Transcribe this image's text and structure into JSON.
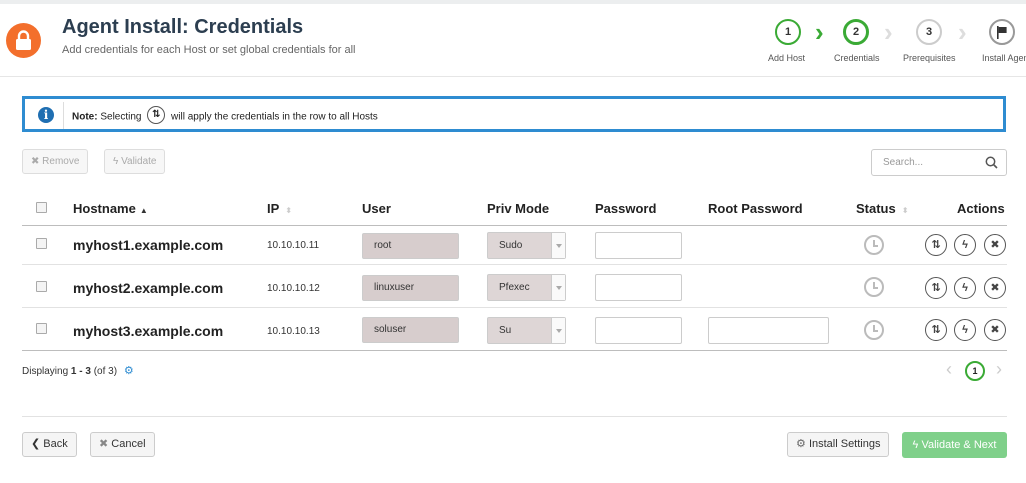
{
  "header": {
    "title": "Agent Install: Credentials",
    "subtitle": "Add credentials for each Host or set global credentials for all"
  },
  "stepper": {
    "steps": [
      {
        "number": "1",
        "label": "Add Host",
        "state": "done"
      },
      {
        "number": "2",
        "label": "Credentials",
        "state": "current"
      },
      {
        "number": "3",
        "label": "Prerequisites",
        "state": "pending"
      },
      {
        "number": "",
        "label": "Install Agent",
        "state": "pending",
        "icon": "flag-icon"
      }
    ]
  },
  "note": {
    "prefix": "Note:",
    "text_before": "Selecting",
    "text_after": "will apply the credentials in the row to all Hosts"
  },
  "toolbar": {
    "remove_label": "Remove",
    "validate_label": "Validate",
    "search_placeholder": "Search..."
  },
  "table": {
    "columns": {
      "hostname": "Hostname",
      "ip": "IP",
      "user": "User",
      "priv_mode": "Priv Mode",
      "password": "Password",
      "root_password": "Root Password",
      "status": "Status",
      "actions": "Actions"
    },
    "rows": [
      {
        "hostname": "myhost1.example.com",
        "ip": "10.10.10.11",
        "user": "root",
        "priv_mode": "Sudo",
        "has_root_password": false
      },
      {
        "hostname": "myhost2.example.com",
        "ip": "10.10.10.12",
        "user": "linuxuser",
        "priv_mode": "Pfexec",
        "has_root_password": false
      },
      {
        "hostname": "myhost3.example.com",
        "ip": "10.10.10.13",
        "user": "soluser",
        "priv_mode": "Su",
        "has_root_password": true
      }
    ]
  },
  "pagination": {
    "displaying_prefix": "Displaying",
    "range": "1 - 3",
    "total": "(of 3)",
    "current_page": "1"
  },
  "footer": {
    "back_label": "Back",
    "cancel_label": "Cancel",
    "install_settings_label": "Install Settings",
    "validate_next_label": "Validate & Next"
  },
  "colors": {
    "accent_orange": "#f36f2c",
    "step_green": "#3aaa35",
    "note_border": "#2e8cd1",
    "primary_button": "#7fd08a"
  }
}
